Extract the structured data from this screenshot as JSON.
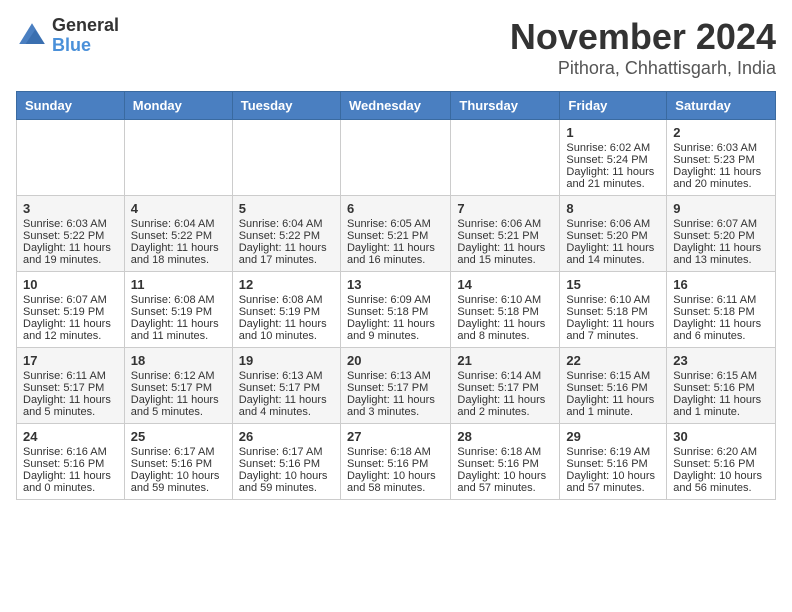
{
  "header": {
    "logo_general": "General",
    "logo_blue": "Blue",
    "month_title": "November 2024",
    "location": "Pithora, Chhattisgarh, India"
  },
  "weekdays": [
    "Sunday",
    "Monday",
    "Tuesday",
    "Wednesday",
    "Thursday",
    "Friday",
    "Saturday"
  ],
  "weeks": [
    [
      {
        "day": "",
        "content": ""
      },
      {
        "day": "",
        "content": ""
      },
      {
        "day": "",
        "content": ""
      },
      {
        "day": "",
        "content": ""
      },
      {
        "day": "",
        "content": ""
      },
      {
        "day": "1",
        "content": "Sunrise: 6:02 AM\nSunset: 5:24 PM\nDaylight: 11 hours and 21 minutes."
      },
      {
        "day": "2",
        "content": "Sunrise: 6:03 AM\nSunset: 5:23 PM\nDaylight: 11 hours and 20 minutes."
      }
    ],
    [
      {
        "day": "3",
        "content": "Sunrise: 6:03 AM\nSunset: 5:22 PM\nDaylight: 11 hours and 19 minutes."
      },
      {
        "day": "4",
        "content": "Sunrise: 6:04 AM\nSunset: 5:22 PM\nDaylight: 11 hours and 18 minutes."
      },
      {
        "day": "5",
        "content": "Sunrise: 6:04 AM\nSunset: 5:22 PM\nDaylight: 11 hours and 17 minutes."
      },
      {
        "day": "6",
        "content": "Sunrise: 6:05 AM\nSunset: 5:21 PM\nDaylight: 11 hours and 16 minutes."
      },
      {
        "day": "7",
        "content": "Sunrise: 6:06 AM\nSunset: 5:21 PM\nDaylight: 11 hours and 15 minutes."
      },
      {
        "day": "8",
        "content": "Sunrise: 6:06 AM\nSunset: 5:20 PM\nDaylight: 11 hours and 14 minutes."
      },
      {
        "day": "9",
        "content": "Sunrise: 6:07 AM\nSunset: 5:20 PM\nDaylight: 11 hours and 13 minutes."
      }
    ],
    [
      {
        "day": "10",
        "content": "Sunrise: 6:07 AM\nSunset: 5:19 PM\nDaylight: 11 hours and 12 minutes."
      },
      {
        "day": "11",
        "content": "Sunrise: 6:08 AM\nSunset: 5:19 PM\nDaylight: 11 hours and 11 minutes."
      },
      {
        "day": "12",
        "content": "Sunrise: 6:08 AM\nSunset: 5:19 PM\nDaylight: 11 hours and 10 minutes."
      },
      {
        "day": "13",
        "content": "Sunrise: 6:09 AM\nSunset: 5:18 PM\nDaylight: 11 hours and 9 minutes."
      },
      {
        "day": "14",
        "content": "Sunrise: 6:10 AM\nSunset: 5:18 PM\nDaylight: 11 hours and 8 minutes."
      },
      {
        "day": "15",
        "content": "Sunrise: 6:10 AM\nSunset: 5:18 PM\nDaylight: 11 hours and 7 minutes."
      },
      {
        "day": "16",
        "content": "Sunrise: 6:11 AM\nSunset: 5:18 PM\nDaylight: 11 hours and 6 minutes."
      }
    ],
    [
      {
        "day": "17",
        "content": "Sunrise: 6:11 AM\nSunset: 5:17 PM\nDaylight: 11 hours and 5 minutes."
      },
      {
        "day": "18",
        "content": "Sunrise: 6:12 AM\nSunset: 5:17 PM\nDaylight: 11 hours and 5 minutes."
      },
      {
        "day": "19",
        "content": "Sunrise: 6:13 AM\nSunset: 5:17 PM\nDaylight: 11 hours and 4 minutes."
      },
      {
        "day": "20",
        "content": "Sunrise: 6:13 AM\nSunset: 5:17 PM\nDaylight: 11 hours and 3 minutes."
      },
      {
        "day": "21",
        "content": "Sunrise: 6:14 AM\nSunset: 5:17 PM\nDaylight: 11 hours and 2 minutes."
      },
      {
        "day": "22",
        "content": "Sunrise: 6:15 AM\nSunset: 5:16 PM\nDaylight: 11 hours and 1 minute."
      },
      {
        "day": "23",
        "content": "Sunrise: 6:15 AM\nSunset: 5:16 PM\nDaylight: 11 hours and 1 minute."
      }
    ],
    [
      {
        "day": "24",
        "content": "Sunrise: 6:16 AM\nSunset: 5:16 PM\nDaylight: 11 hours and 0 minutes."
      },
      {
        "day": "25",
        "content": "Sunrise: 6:17 AM\nSunset: 5:16 PM\nDaylight: 10 hours and 59 minutes."
      },
      {
        "day": "26",
        "content": "Sunrise: 6:17 AM\nSunset: 5:16 PM\nDaylight: 10 hours and 59 minutes."
      },
      {
        "day": "27",
        "content": "Sunrise: 6:18 AM\nSunset: 5:16 PM\nDaylight: 10 hours and 58 minutes."
      },
      {
        "day": "28",
        "content": "Sunrise: 6:18 AM\nSunset: 5:16 PM\nDaylight: 10 hours and 57 minutes."
      },
      {
        "day": "29",
        "content": "Sunrise: 6:19 AM\nSunset: 5:16 PM\nDaylight: 10 hours and 57 minutes."
      },
      {
        "day": "30",
        "content": "Sunrise: 6:20 AM\nSunset: 5:16 PM\nDaylight: 10 hours and 56 minutes."
      }
    ]
  ]
}
